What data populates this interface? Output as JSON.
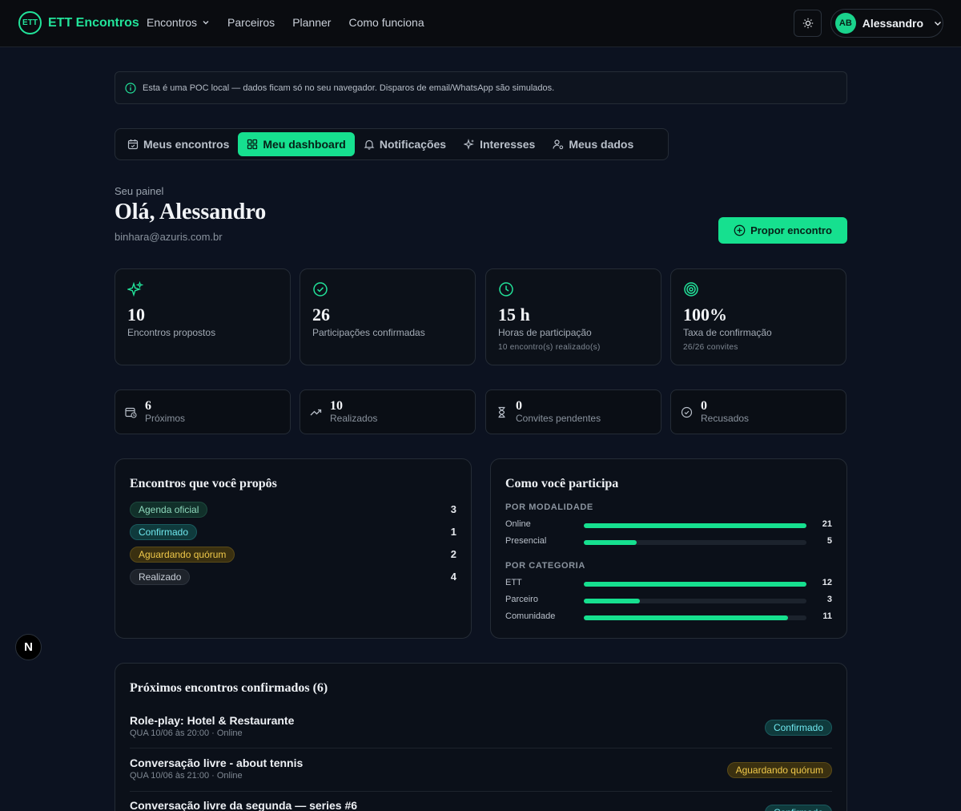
{
  "header": {
    "logo_text": "ETT",
    "brand": "ETT Encontros",
    "nav": [
      "Encontros",
      "Parceiros",
      "Planner",
      "Como funciona"
    ],
    "user_initials": "AB",
    "user_name": "Alessandro"
  },
  "notice": "Esta é uma POC local — dados ficam só no seu navegador. Disparos de email/WhatsApp são simulados.",
  "tabs": [
    "Meus encontros",
    "Meu dashboard",
    "Notificações",
    "Interesses",
    "Meus dados"
  ],
  "active_tab": "Meu dashboard",
  "page": {
    "subtitle": "Seu painel",
    "greeting": "Olá, Alessandro",
    "email": "binhara@azuris.com.br",
    "propose_button": "Propor encontro"
  },
  "stats": [
    {
      "icon": "sparkles-icon",
      "value": "10",
      "label": "Encontros propostos",
      "sub": ""
    },
    {
      "icon": "check-circle-icon",
      "value": "26",
      "label": "Participações confirmadas",
      "sub": ""
    },
    {
      "icon": "clock-icon",
      "value": "15 h",
      "label": "Horas de participação",
      "sub": "10 encontro(s) realizado(s)"
    },
    {
      "icon": "target-icon",
      "value": "100%",
      "label": "Taxa de confirmação",
      "sub": "26/26 convites"
    }
  ],
  "mini_stats": [
    {
      "icon": "calendar-clock-icon",
      "value": "6",
      "label": "Próximos"
    },
    {
      "icon": "trending-up-icon",
      "value": "10",
      "label": "Realizados"
    },
    {
      "icon": "hourglass-icon",
      "value": "0",
      "label": "Convites pendentes"
    },
    {
      "icon": "check-circle-icon",
      "value": "0",
      "label": "Recusados"
    }
  ],
  "proposed": {
    "title": "Encontros que você propôs",
    "items": [
      {
        "label": "Agenda oficial",
        "count": "3"
      },
      {
        "label": "Confirmado",
        "count": "1"
      },
      {
        "label": "Aguardando quórum",
        "count": "2"
      },
      {
        "label": "Realizado",
        "count": "4"
      }
    ]
  },
  "participation": {
    "title": "Como você participa",
    "modality_label": "POR MODALIDADE",
    "modality": [
      {
        "name": "Online",
        "value": 21,
        "fraction": 1.0
      },
      {
        "name": "Presencial",
        "value": 5,
        "fraction": 0.238
      }
    ],
    "category_label": "POR CATEGORIA",
    "category": [
      {
        "name": "ETT",
        "value": 12,
        "fraction": 1.0
      },
      {
        "name": "Parceiro",
        "value": 3,
        "fraction": 0.25
      },
      {
        "name": "Comunidade",
        "value": 11,
        "fraction": 0.917
      }
    ]
  },
  "upcoming": {
    "title": "Próximos encontros confirmados (6)",
    "items": [
      {
        "title": "Role-play: Hotel & Restaurante",
        "meta": "QUA 10/06 às 20:00 · Online",
        "status": "Confirmado"
      },
      {
        "title": "Conversação livre - about tennis",
        "meta": "QUA 10/06 às 21:00 · Online",
        "status": "Aguardando quórum"
      },
      {
        "title": "Conversação livre da segunda — series #6",
        "meta": "",
        "status": "Confirmado"
      }
    ]
  },
  "dev_badge": "N"
}
